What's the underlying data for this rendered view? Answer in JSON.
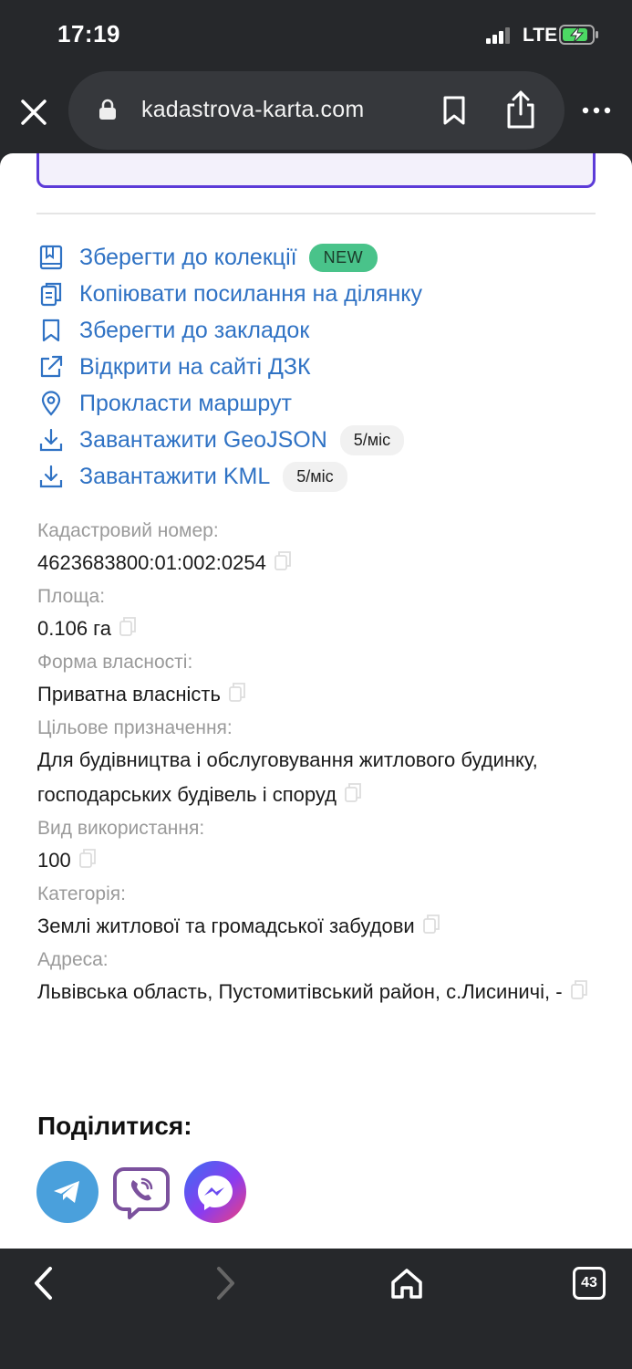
{
  "status_bar": {
    "time": "17:19",
    "network": "LTE"
  },
  "browser": {
    "url": "kadastrova-karta.com",
    "tab_count": "43"
  },
  "actions": [
    {
      "label": "Зберегти до колекції",
      "icon": "collection-icon",
      "badge": "NEW"
    },
    {
      "label": "Копіювати посилання на ділянку",
      "icon": "copy-link-icon"
    },
    {
      "label": "Зберегти до закладок",
      "icon": "bookmark-icon"
    },
    {
      "label": "Відкрити на сайті ДЗК",
      "icon": "external-link-icon"
    },
    {
      "label": "Прокласти маршрут",
      "icon": "location-pin-icon"
    },
    {
      "label": "Завантажити GeoJSON",
      "icon": "download-icon",
      "limit": "5/міс"
    },
    {
      "label": "Завантажити KML",
      "icon": "download-icon",
      "limit": "5/міс"
    }
  ],
  "fields": [
    {
      "label": "Кадастровий номер:",
      "value": "4623683800:01:002:0254"
    },
    {
      "label": "Площа:",
      "value": "0.106 га"
    },
    {
      "label": "Форма власності:",
      "value": "Приватна власність"
    },
    {
      "label": "Цільове призначення:",
      "value": "Для будівництва і обслуговування житлового будинку, господарських будівель і споруд"
    },
    {
      "label": "Вид використання:",
      "value": "100"
    },
    {
      "label": "Категорія:",
      "value": "Землі житлової та громадської забудови"
    },
    {
      "label": "Адреса:",
      "value": "Львівська область, Пустомитівський район, с.Лисиничі, -"
    }
  ],
  "share": {
    "title": "Поділитися:",
    "buttons": [
      "telegram-icon",
      "viber-icon",
      "messenger-icon"
    ]
  },
  "colors": {
    "link": "#2f72c4",
    "badge_new": "#49c38a",
    "accent_border": "#5c3bd8",
    "telegram": "#4aa0dc",
    "viber": "#7b519d"
  }
}
